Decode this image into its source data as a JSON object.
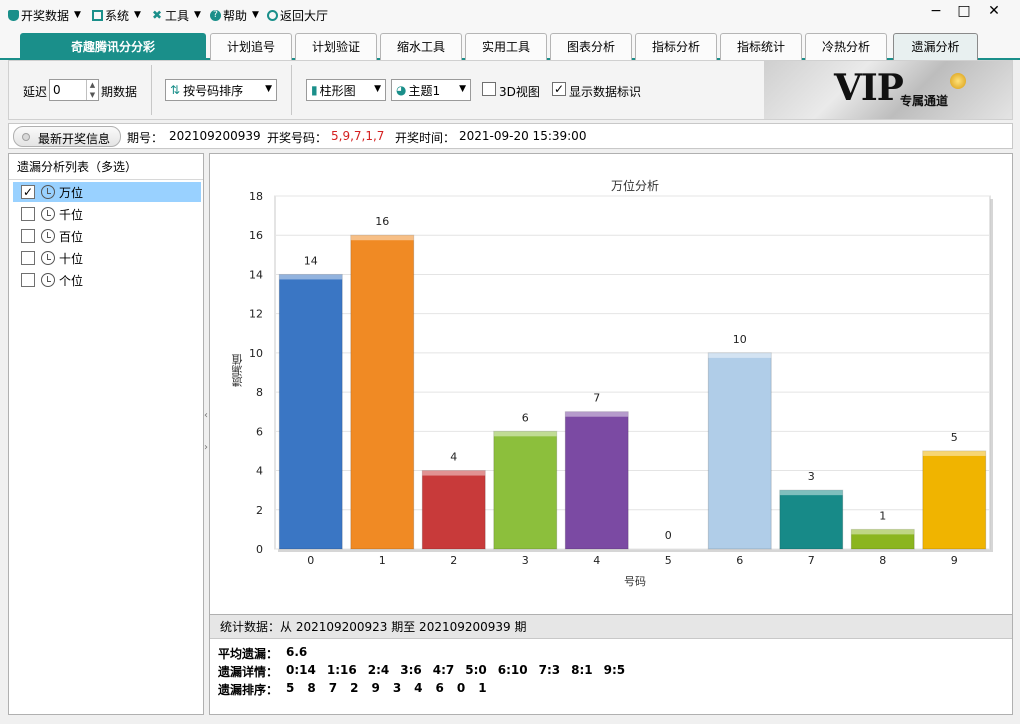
{
  "menubar": {
    "items": [
      {
        "label": "开奖数据",
        "icon": "trophy-icon",
        "has_arrow": true
      },
      {
        "label": "系统",
        "icon": "monitor-icon",
        "has_arrow": true
      },
      {
        "label": "工具",
        "icon": "tools-icon",
        "has_arrow": true
      },
      {
        "label": "帮助",
        "icon": "help-icon",
        "has_arrow": true
      },
      {
        "label": "返回大厅",
        "icon": "return-icon",
        "has_arrow": false
      }
    ],
    "window_controls": [
      "−",
      "□",
      "✕"
    ]
  },
  "tabs": {
    "brand": "奇趣腾讯分分彩",
    "items": [
      "计划追号",
      "计划验证",
      "缩水工具",
      "实用工具",
      "图表分析",
      "指标分析",
      "指标统计",
      "冷热分析",
      "遗漏分析"
    ],
    "active": "遗漏分析"
  },
  "toolbar": {
    "delay_label": "延迟",
    "delay_value": "0",
    "period_label": "期数据",
    "sort_combo": "按号码排序",
    "chart_type_combo": "柱形图",
    "theme_combo": "主题1",
    "view3d_label": "3D视图",
    "view3d_checked": false,
    "show_labels_label": "显示数据标识",
    "show_labels_checked": true
  },
  "vip_banner": {
    "big": "VIP",
    "small": "专属通道"
  },
  "infobar": {
    "latest_button": "最新开奖信息",
    "period_label": "期号：",
    "period_value": "202109200939",
    "number_label": "开奖号码：",
    "number_value": "5,9,7,1,7",
    "time_label": "开奖时间：",
    "time_value": "2021-09-20 15:39:00"
  },
  "left_panel": {
    "title": "遗漏分析列表（多选）",
    "items": [
      {
        "label": "万位",
        "checked": true,
        "selected": true
      },
      {
        "label": "千位",
        "checked": false,
        "selected": false
      },
      {
        "label": "百位",
        "checked": false,
        "selected": false
      },
      {
        "label": "十位",
        "checked": false,
        "selected": false
      },
      {
        "label": "个位",
        "checked": false,
        "selected": false
      }
    ]
  },
  "chart_data": {
    "type": "bar",
    "title": "万位分析",
    "xlabel": "号码",
    "ylabel": "遗漏值",
    "categories": [
      "0",
      "1",
      "2",
      "3",
      "4",
      "5",
      "6",
      "7",
      "8",
      "9"
    ],
    "values": [
      14,
      16,
      4,
      6,
      7,
      0,
      10,
      3,
      1,
      5
    ],
    "ylim": [
      0,
      18
    ],
    "yticks": [
      0,
      2,
      4,
      6,
      8,
      10,
      12,
      14,
      16,
      18
    ],
    "grid": true,
    "data_labels": true,
    "colors": [
      "#3a76c4",
      "#f08a24",
      "#c83a3a",
      "#8cbf3c",
      "#7b4aa3",
      "#9e9e9e",
      "#b0cde8",
      "#178a88",
      "#8bb51f",
      "#f0b400"
    ]
  },
  "stats": {
    "header": "统计数据：从 202109200923 期至 202109200939 期",
    "avg_label": "平均遗漏：",
    "avg_value": "6.6",
    "detail_label": "遗漏详情：",
    "detail_values": [
      "0:14",
      "1:16",
      "2:4",
      "3:6",
      "4:7",
      "5:0",
      "6:10",
      "7:3",
      "8:1",
      "9:5"
    ],
    "rank_label": "遗漏排序：",
    "rank_values": [
      "5",
      "8",
      "7",
      "2",
      "9",
      "3",
      "4",
      "6",
      "0",
      "1"
    ]
  }
}
